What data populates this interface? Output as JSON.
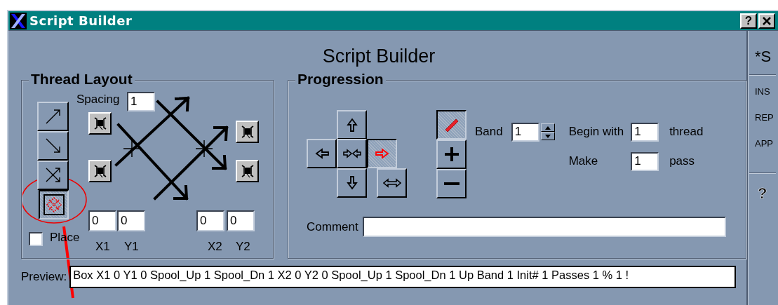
{
  "window": {
    "title": "Script Builder",
    "help_button": "?"
  },
  "heading": "Script Builder",
  "thread_layout": {
    "title": "Thread Layout",
    "modes": [
      {
        "kind": "diagonal-up",
        "selected": false
      },
      {
        "kind": "diagonal-down",
        "selected": false
      },
      {
        "kind": "cross",
        "selected": false
      },
      {
        "kind": "box",
        "selected": true
      }
    ],
    "spacing_label": "Spacing",
    "spacing": "1",
    "coordinates": [
      {
        "label": "X1",
        "value": "0"
      },
      {
        "label": "Y1",
        "value": "0"
      },
      {
        "label": "X2",
        "value": "0"
      },
      {
        "label": "Y2",
        "value": "0"
      }
    ],
    "place": {
      "label": "Place",
      "checked": false
    }
  },
  "progression": {
    "title": "Progression",
    "directions": [
      {
        "kind": "up",
        "selected": false
      },
      {
        "kind": "left",
        "selected": false
      },
      {
        "kind": "inward",
        "selected": false
      },
      {
        "kind": "right",
        "selected": true
      },
      {
        "kind": "down",
        "selected": false
      },
      {
        "kind": "swap",
        "selected": false
      }
    ],
    "tools": [
      {
        "kind": "pencil",
        "selected": true
      },
      {
        "kind": "plus",
        "selected": false
      },
      {
        "kind": "minus",
        "selected": false
      }
    ],
    "band": {
      "label": "Band",
      "value": "1"
    },
    "begin_with": {
      "label": "Begin with",
      "value": "1",
      "unit": "thread"
    },
    "make": {
      "label": "Make",
      "value": "1",
      "unit": "pass"
    },
    "comment": {
      "label": "Comment"
    }
  },
  "preview": {
    "label": "Preview:",
    "value": "Box X1 0 Y1 0 Spool_Up 1 Spool_Dn 1 X2 0 Y2 0 Spool_Up 1 Spool_Dn 1 Up Band 1 Init# 1 Passes 1 % 1 !"
  },
  "side": {
    "title": "*S",
    "items": [
      "INS",
      "REP",
      "APP"
    ],
    "help": "?"
  }
}
